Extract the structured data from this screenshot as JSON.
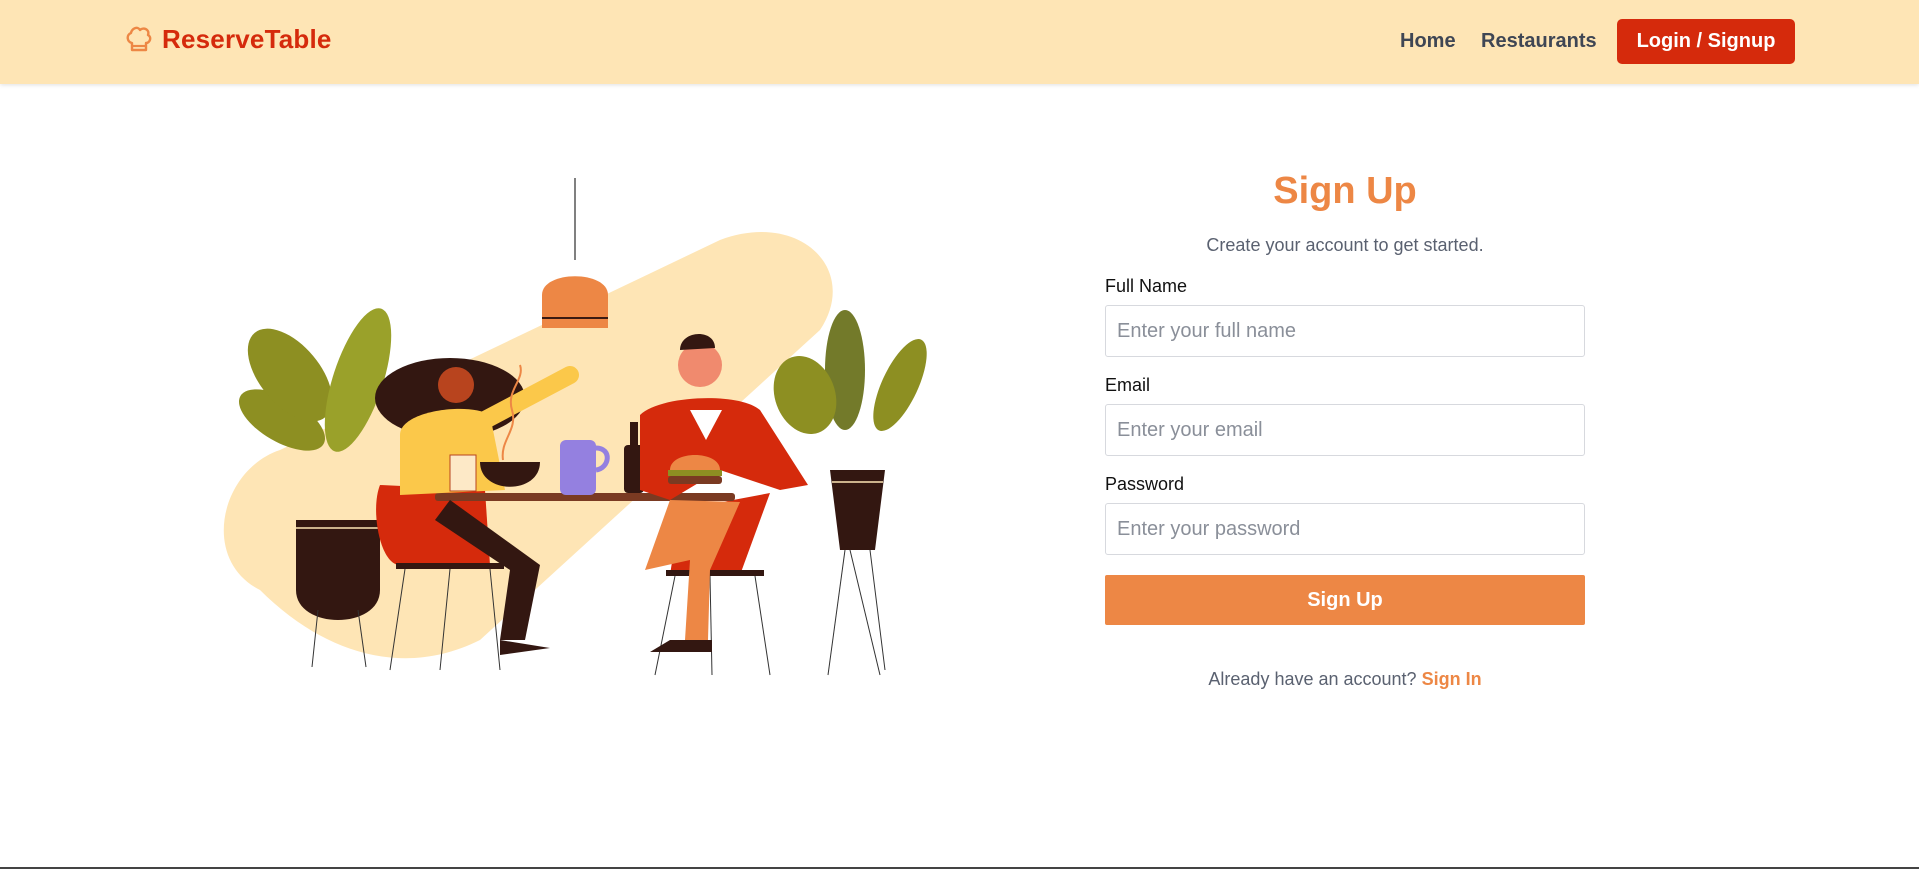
{
  "app": {
    "name": "ReserveTable",
    "brand_color": "#d52a0c",
    "accent_color": "#ed8745",
    "header_bg": "#fee5b5"
  },
  "nav": {
    "home_label": "Home",
    "restaurants_label": "Restaurants",
    "cta_label": "Login / Signup",
    "logo_icon": "chef-hat-icon"
  },
  "form": {
    "title": "Sign Up",
    "subtitle": "Create your account to get started.",
    "fields": [
      {
        "label": "Full Name",
        "placeholder": "Enter your full name",
        "value": ""
      },
      {
        "label": "Email",
        "placeholder": "Enter your email",
        "value": ""
      },
      {
        "label": "Password",
        "placeholder": "Enter your password",
        "value": ""
      }
    ],
    "submit_label": "Sign Up",
    "signin_prompt": "Already have an account?",
    "signin_link": "Sign In"
  },
  "illustration": {
    "subject": "dining-couple-illustration"
  }
}
